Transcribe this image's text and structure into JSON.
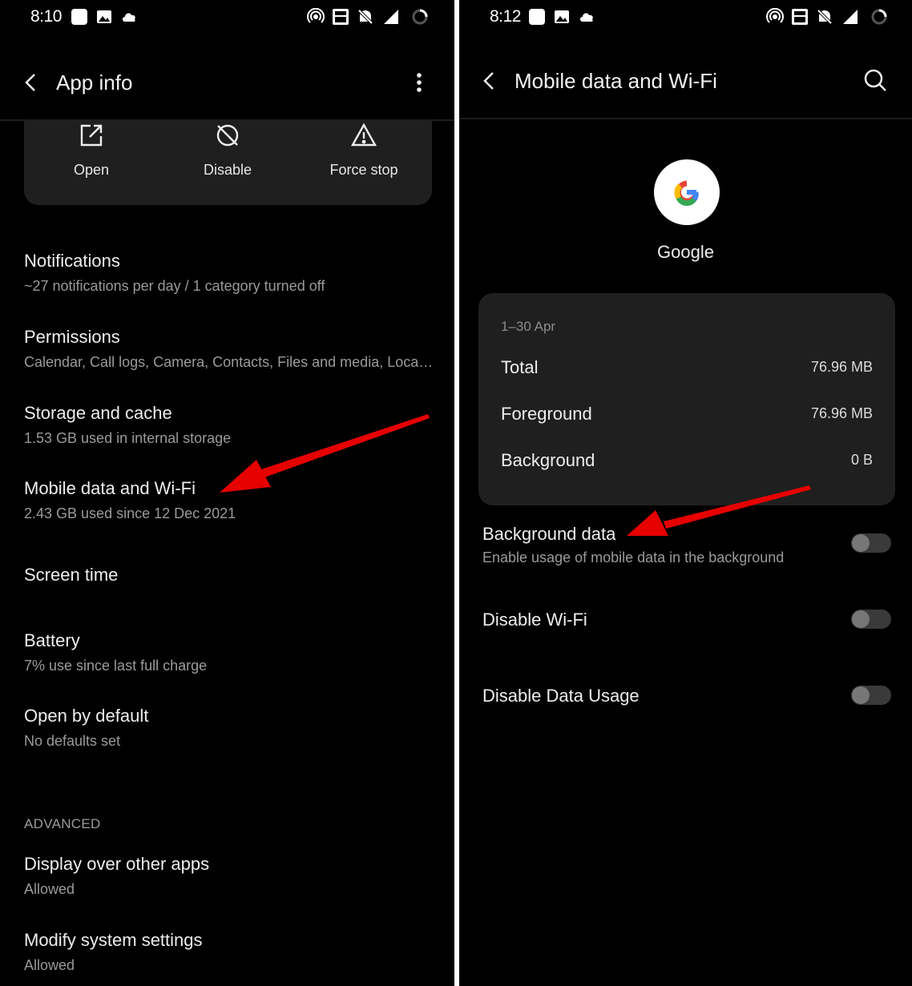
{
  "colors": {
    "background": "#000000",
    "card": "#1f1f1f",
    "primary_text": "#eeeeee",
    "secondary_text": "#9a9a9a",
    "annotation_arrow": "#e60000",
    "switch_track": "#3a3a3a",
    "switch_knob": "#777777"
  },
  "left_screen": {
    "status_bar": {
      "time": "8:10",
      "icons": [
        "app-notification-icon",
        "gallery-icon",
        "cloud-icon",
        "hotspot-icon",
        "volte-icon",
        "silent-icon",
        "signal-4g-icon",
        "battery-saver-icon"
      ]
    },
    "app_bar": {
      "title": "App info"
    },
    "actions": [
      {
        "label": "Open",
        "icon": "open-external-icon"
      },
      {
        "label": "Disable",
        "icon": "disable-icon"
      },
      {
        "label": "Force stop",
        "icon": "warning-icon"
      }
    ],
    "settings": [
      {
        "title": "Notifications",
        "subtitle": "~27 notifications per day / 1 category turned off"
      },
      {
        "title": "Permissions",
        "subtitle": "Calendar, Call logs, Camera, Contacts, Files and media, Loca…"
      },
      {
        "title": "Storage and cache",
        "subtitle": "1.53 GB used in internal storage"
      },
      {
        "title": "Mobile data and Wi-Fi",
        "subtitle": "2.43 GB used since 12 Dec 2021"
      },
      {
        "title": "Screen time",
        "subtitle": ""
      },
      {
        "title": "Battery",
        "subtitle": "7% use since last full charge"
      },
      {
        "title": "Open by default",
        "subtitle": "No defaults set"
      }
    ],
    "advanced": {
      "header": "ADVANCED",
      "items": [
        {
          "title": "Display over other apps",
          "subtitle": "Allowed"
        },
        {
          "title": "Modify system settings",
          "subtitle": "Allowed"
        }
      ]
    }
  },
  "right_screen": {
    "status_bar": {
      "time": "8:12",
      "icons": [
        "app-notification-icon",
        "gallery-icon",
        "cloud-icon",
        "hotspot-icon",
        "volte-icon",
        "silent-icon",
        "signal-4g-icon",
        "battery-saver-icon"
      ]
    },
    "app_bar": {
      "title": "Mobile data and Wi-Fi"
    },
    "app": {
      "name": "Google",
      "icon": "google-logo"
    },
    "usage": {
      "period": "1–30 Apr",
      "rows": [
        {
          "label": "Total",
          "value": "76.96 MB"
        },
        {
          "label": "Foreground",
          "value": "76.96 MB"
        },
        {
          "label": "Background",
          "value": "0 B"
        }
      ]
    },
    "toggles": [
      {
        "title": "Background data",
        "subtitle": "Enable usage of mobile data in the background",
        "enabled": false
      },
      {
        "title": "Disable Wi-Fi",
        "subtitle": "",
        "enabled": false
      },
      {
        "title": "Disable Data Usage",
        "subtitle": "",
        "enabled": false
      }
    ]
  }
}
